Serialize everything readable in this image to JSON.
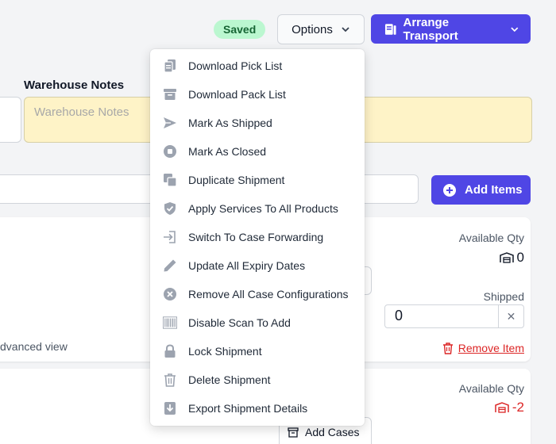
{
  "header": {
    "status_badge": "Saved",
    "options_label": "Options",
    "transport_label": "Arrange Transport"
  },
  "colors": {
    "accent": "#4f46e5",
    "notes_bg": "#fef3c7",
    "danger": "#dc2626",
    "saved_bg": "#bbf7d0"
  },
  "notes": {
    "label": "Warehouse Notes",
    "placeholder": "Warehouse Notes"
  },
  "toolbar": {
    "add_items_label": "Add Items"
  },
  "items": [
    {
      "available_qty_label": "Available Qty",
      "available_qty": "0",
      "shipped_label": "Shipped",
      "shipped_value": "0",
      "remove_label": "Remove Item",
      "advanced_label": "dvanced view"
    },
    {
      "available_qty_label": "Available Qty",
      "available_qty": "-2",
      "add_cases_label": "Add Cases"
    }
  ],
  "menu": {
    "items": [
      {
        "label": "Download Pick List",
        "icon": "document-duplicate-icon"
      },
      {
        "label": "Download Pack List",
        "icon": "archive-box-icon"
      },
      {
        "label": "Mark As Shipped",
        "icon": "paper-airplane-icon"
      },
      {
        "label": "Mark As Closed",
        "icon": "stop-circle-icon"
      },
      {
        "label": "Duplicate Shipment",
        "icon": "duplicate-icon"
      },
      {
        "label": "Apply Services To All Products",
        "icon": "shield-check-icon"
      },
      {
        "label": "Switch To Case Forwarding",
        "icon": "login-icon"
      },
      {
        "label": "Update All Expiry Dates",
        "icon": "pencil-icon"
      },
      {
        "label": "Remove All Case Configurations",
        "icon": "x-circle-icon"
      },
      {
        "label": "Disable Scan To Add",
        "icon": "barcode-icon"
      },
      {
        "label": "Lock Shipment",
        "icon": "lock-icon"
      },
      {
        "label": "Delete Shipment",
        "icon": "trash-icon"
      },
      {
        "label": "Export Shipment Details",
        "icon": "download-icon"
      }
    ]
  }
}
